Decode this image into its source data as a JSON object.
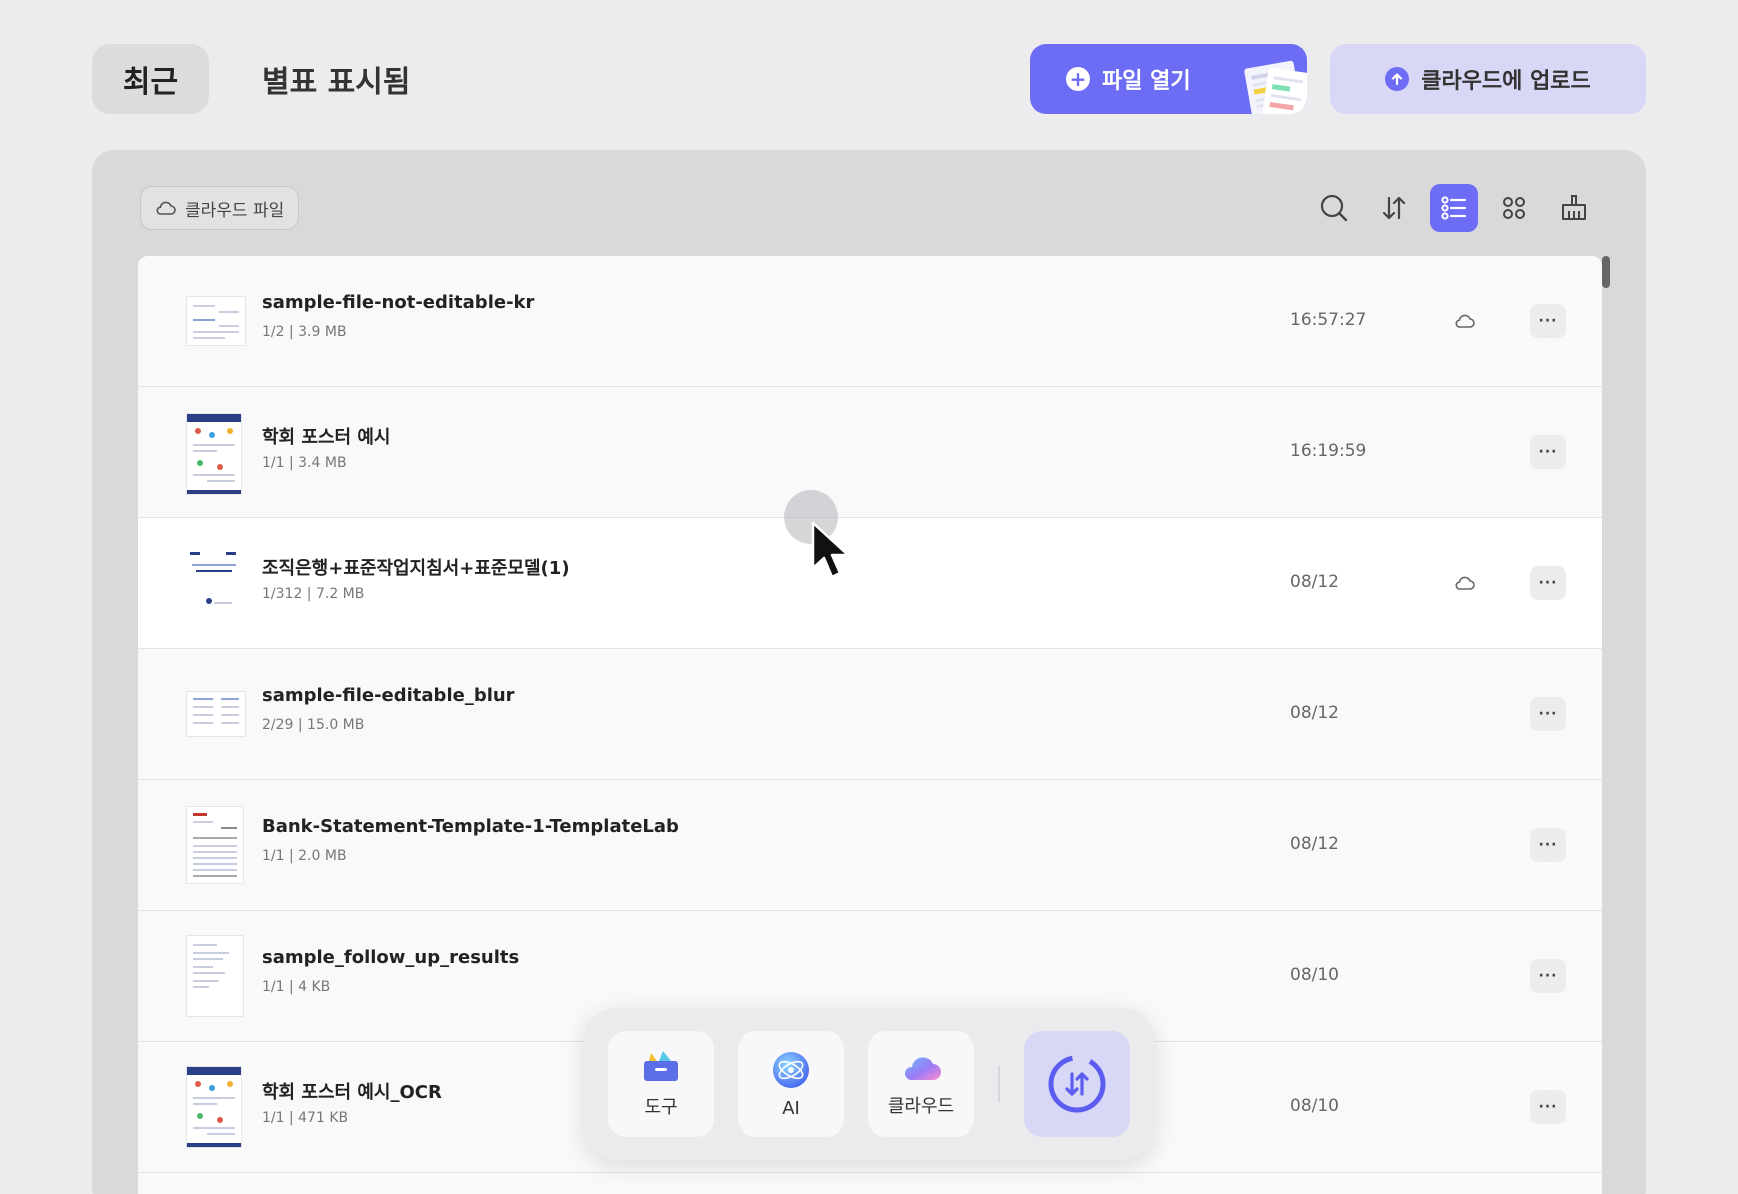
{
  "header": {
    "tab_recent": "최근",
    "tab_starred": "별표 표시됨",
    "open_file": "파일 열기",
    "upload_cloud": "클라우드에 업로드"
  },
  "panel": {
    "cloud_files_label": "클라우드 파일",
    "toolbar": [
      "search-icon",
      "sort-icon",
      "list-view-icon",
      "grid-view-icon",
      "trash-icon"
    ],
    "active_view": "list"
  },
  "files": [
    {
      "name": "sample-file-not-editable-kr",
      "meta": "1/2 | 3.9 MB",
      "time": "16:57:27",
      "cloud": true
    },
    {
      "name": "학회 포스터 예시",
      "meta": "1/1 | 3.4 MB",
      "time": "16:19:59",
      "cloud": false
    },
    {
      "name": "조직은행+표준작업지침서+표준모델(1)",
      "meta": "1/312 | 7.2 MB",
      "time": "08/12",
      "cloud": true
    },
    {
      "name": "sample-file-editable_blur",
      "meta": "2/29 | 15.0 MB",
      "time": "08/12",
      "cloud": false
    },
    {
      "name": "Bank-Statement-Template-1-TemplateLab",
      "meta": "1/1 | 2.0 MB",
      "time": "08/12",
      "cloud": false
    },
    {
      "name": "sample_follow_up_results",
      "meta": "1/1 | 4 KB",
      "time": "08/10",
      "cloud": false
    },
    {
      "name": "학회 포스터 예시_OCR",
      "meta": "1/1 | 471 KB",
      "time": "08/10",
      "cloud": false
    }
  ],
  "more_label": "···",
  "dock": {
    "tools": "도구",
    "ai": "AI",
    "cloud": "클라우드"
  },
  "colors": {
    "accent": "#6d6cf5",
    "accent_light": "#d8d8f6",
    "background": "#ececee"
  }
}
